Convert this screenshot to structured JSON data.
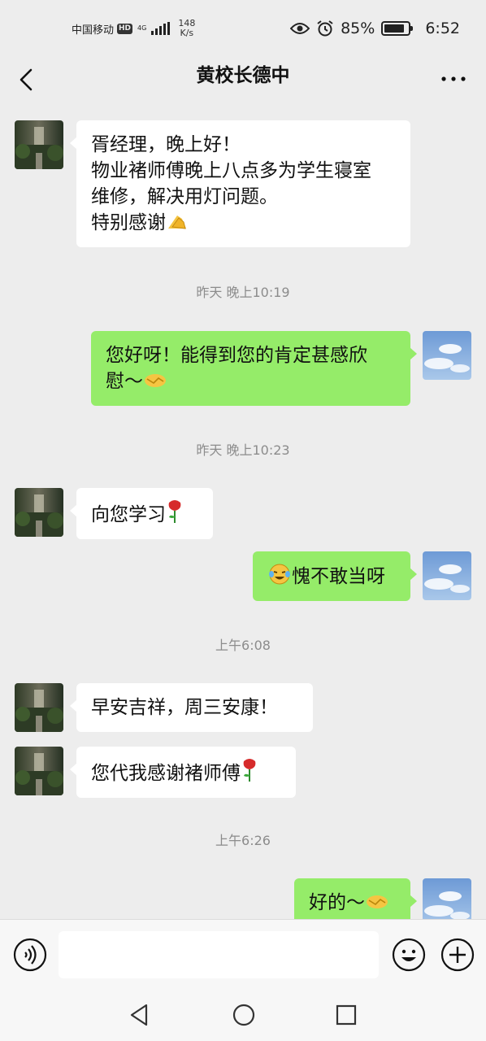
{
  "status_bar": {
    "carrier": "中国移动",
    "hd_badge": "HD",
    "network_tag": "4G",
    "speed_value": "148",
    "speed_unit": "K/s",
    "battery_percent": "85%",
    "battery_level": 0.85,
    "time": "6:52",
    "icons": [
      "eye-icon",
      "alarm-icon",
      "battery-icon",
      "signal-icon"
    ]
  },
  "header": {
    "title": "黄校长德中",
    "back_icon": "chevron-left-icon",
    "more_icon": "more-icon"
  },
  "messages": [
    {
      "type": "in",
      "lines": [
        "胥经理，晚上好！",
        "物业褚师傅晚上八点多为学生寝室",
        "维修，解决用灯问题。",
        "特别感谢"
      ],
      "emoji": "folded-hands-emoji"
    },
    {
      "type": "time",
      "text": "昨天 晚上10:19"
    },
    {
      "type": "out",
      "lines": [
        "您好呀！能得到您的肯定甚感欣",
        "慰～"
      ],
      "emoji": "handshake-emoji"
    },
    {
      "type": "time",
      "text": "昨天 晚上10:23"
    },
    {
      "type": "in",
      "lines": [
        "向您学习"
      ],
      "emoji": "rose-emoji"
    },
    {
      "type": "out",
      "lines": [
        "愧不敢当呀"
      ],
      "emoji_leading": "laughing-tears-emoji"
    },
    {
      "type": "time",
      "text": "上午6:08"
    },
    {
      "type": "in",
      "lines": [
        "早安吉祥，周三安康！"
      ]
    },
    {
      "type": "in",
      "lines": [
        "您代我感谢褚师傅"
      ],
      "emoji": "rose-emoji"
    },
    {
      "type": "time",
      "text": "上午6:26"
    },
    {
      "type": "out",
      "lines": [
        "好的～"
      ],
      "emoji": "handshake-emoji"
    }
  ],
  "input_bar": {
    "value": "",
    "placeholder": "",
    "voice_icon": "voice-icon",
    "emoji_icon": "emoji-face-icon",
    "plus_icon": "plus-icon"
  },
  "system_nav": {
    "icons": [
      "triangle-back-icon",
      "circle-home-icon",
      "square-recents-icon"
    ]
  },
  "colors": {
    "background": "#ededed",
    "incoming_bubble": "#ffffff",
    "outgoing_bubble": "#95ec69",
    "timestamp_text": "#8c8c8c"
  }
}
